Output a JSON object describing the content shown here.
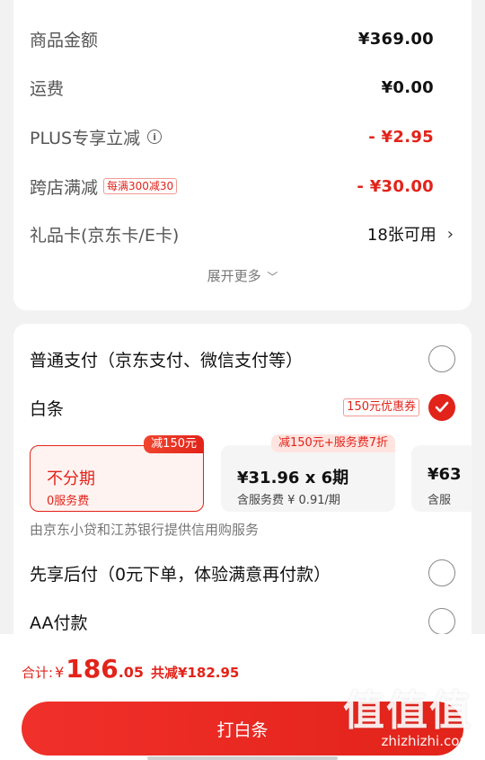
{
  "price_summary": {
    "goods_amount": {
      "label": "商品金额",
      "value": "¥369.00"
    },
    "shipping": {
      "label": "运费",
      "value": "¥0.00"
    },
    "plus_discount": {
      "label": "PLUS专享立减",
      "value": "- ¥2.95",
      "icon": "info-icon"
    },
    "cross_store": {
      "label": "跨店满减",
      "tag": "每满300减30",
      "value": "- ¥30.00"
    },
    "gift_card": {
      "label": "礼品卡(京东卡/E卡)",
      "value": "18张可用"
    },
    "expand_label": "展开更多"
  },
  "payment": {
    "normal": {
      "label": "普通支付（京东支付、微信支付等）",
      "checked": false
    },
    "baitiao": {
      "label": "白条",
      "coupon_tag": "150元优惠券",
      "checked": true
    },
    "plans": [
      {
        "badge": "减150元",
        "title": "不分期",
        "sub": "0服务费",
        "selected": true
      },
      {
        "badge": "减150元+服务费7折",
        "title": "¥31.96 x 6期",
        "sub": "含服务费 ¥ 0.91/期",
        "selected": false
      },
      {
        "title": "¥63",
        "sub": "含服",
        "selected": false
      }
    ],
    "credit_note": "由京东小贷和江苏银行提供信用购服务",
    "pay_later": {
      "label": "先享后付（0元下单，体验满意再付款）",
      "checked": false
    },
    "aa": {
      "label": "AA付款",
      "checked": false
    }
  },
  "bottom_bar": {
    "total_label": "合计:",
    "currency": "¥",
    "total_int": "186",
    "total_dec": ".05",
    "saved": "共减¥182.95",
    "cta": "打白条"
  },
  "watermark": {
    "logo": "值值值",
    "url": "zhizhizhi.com"
  },
  "colors": {
    "accent": "#e2231a",
    "background": "#f2f2f2",
    "card": "#ffffff"
  }
}
